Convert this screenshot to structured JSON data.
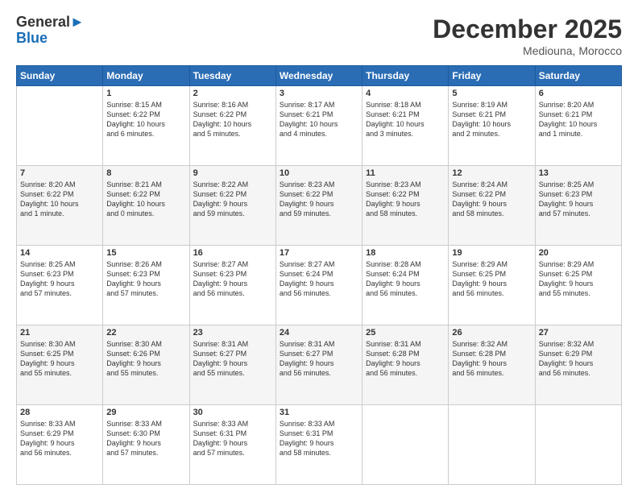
{
  "header": {
    "logo_line1": "General",
    "logo_line2": "Blue",
    "month": "December 2025",
    "location": "Mediouna, Morocco"
  },
  "weekdays": [
    "Sunday",
    "Monday",
    "Tuesday",
    "Wednesday",
    "Thursday",
    "Friday",
    "Saturday"
  ],
  "weeks": [
    [
      {
        "day": "",
        "info": ""
      },
      {
        "day": "1",
        "info": "Sunrise: 8:15 AM\nSunset: 6:22 PM\nDaylight: 10 hours\nand 6 minutes."
      },
      {
        "day": "2",
        "info": "Sunrise: 8:16 AM\nSunset: 6:22 PM\nDaylight: 10 hours\nand 5 minutes."
      },
      {
        "day": "3",
        "info": "Sunrise: 8:17 AM\nSunset: 6:21 PM\nDaylight: 10 hours\nand 4 minutes."
      },
      {
        "day": "4",
        "info": "Sunrise: 8:18 AM\nSunset: 6:21 PM\nDaylight: 10 hours\nand 3 minutes."
      },
      {
        "day": "5",
        "info": "Sunrise: 8:19 AM\nSunset: 6:21 PM\nDaylight: 10 hours\nand 2 minutes."
      },
      {
        "day": "6",
        "info": "Sunrise: 8:20 AM\nSunset: 6:21 PM\nDaylight: 10 hours\nand 1 minute."
      }
    ],
    [
      {
        "day": "7",
        "info": "Sunrise: 8:20 AM\nSunset: 6:22 PM\nDaylight: 10 hours\nand 1 minute."
      },
      {
        "day": "8",
        "info": "Sunrise: 8:21 AM\nSunset: 6:22 PM\nDaylight: 10 hours\nand 0 minutes."
      },
      {
        "day": "9",
        "info": "Sunrise: 8:22 AM\nSunset: 6:22 PM\nDaylight: 9 hours\nand 59 minutes."
      },
      {
        "day": "10",
        "info": "Sunrise: 8:23 AM\nSunset: 6:22 PM\nDaylight: 9 hours\nand 59 minutes."
      },
      {
        "day": "11",
        "info": "Sunrise: 8:23 AM\nSunset: 6:22 PM\nDaylight: 9 hours\nand 58 minutes."
      },
      {
        "day": "12",
        "info": "Sunrise: 8:24 AM\nSunset: 6:22 PM\nDaylight: 9 hours\nand 58 minutes."
      },
      {
        "day": "13",
        "info": "Sunrise: 8:25 AM\nSunset: 6:23 PM\nDaylight: 9 hours\nand 57 minutes."
      }
    ],
    [
      {
        "day": "14",
        "info": "Sunrise: 8:25 AM\nSunset: 6:23 PM\nDaylight: 9 hours\nand 57 minutes."
      },
      {
        "day": "15",
        "info": "Sunrise: 8:26 AM\nSunset: 6:23 PM\nDaylight: 9 hours\nand 57 minutes."
      },
      {
        "day": "16",
        "info": "Sunrise: 8:27 AM\nSunset: 6:23 PM\nDaylight: 9 hours\nand 56 minutes."
      },
      {
        "day": "17",
        "info": "Sunrise: 8:27 AM\nSunset: 6:24 PM\nDaylight: 9 hours\nand 56 minutes."
      },
      {
        "day": "18",
        "info": "Sunrise: 8:28 AM\nSunset: 6:24 PM\nDaylight: 9 hours\nand 56 minutes."
      },
      {
        "day": "19",
        "info": "Sunrise: 8:29 AM\nSunset: 6:25 PM\nDaylight: 9 hours\nand 56 minutes."
      },
      {
        "day": "20",
        "info": "Sunrise: 8:29 AM\nSunset: 6:25 PM\nDaylight: 9 hours\nand 55 minutes."
      }
    ],
    [
      {
        "day": "21",
        "info": "Sunrise: 8:30 AM\nSunset: 6:25 PM\nDaylight: 9 hours\nand 55 minutes."
      },
      {
        "day": "22",
        "info": "Sunrise: 8:30 AM\nSunset: 6:26 PM\nDaylight: 9 hours\nand 55 minutes."
      },
      {
        "day": "23",
        "info": "Sunrise: 8:31 AM\nSunset: 6:27 PM\nDaylight: 9 hours\nand 55 minutes."
      },
      {
        "day": "24",
        "info": "Sunrise: 8:31 AM\nSunset: 6:27 PM\nDaylight: 9 hours\nand 56 minutes."
      },
      {
        "day": "25",
        "info": "Sunrise: 8:31 AM\nSunset: 6:28 PM\nDaylight: 9 hours\nand 56 minutes."
      },
      {
        "day": "26",
        "info": "Sunrise: 8:32 AM\nSunset: 6:28 PM\nDaylight: 9 hours\nand 56 minutes."
      },
      {
        "day": "27",
        "info": "Sunrise: 8:32 AM\nSunset: 6:29 PM\nDaylight: 9 hours\nand 56 minutes."
      }
    ],
    [
      {
        "day": "28",
        "info": "Sunrise: 8:33 AM\nSunset: 6:29 PM\nDaylight: 9 hours\nand 56 minutes."
      },
      {
        "day": "29",
        "info": "Sunrise: 8:33 AM\nSunset: 6:30 PM\nDaylight: 9 hours\nand 57 minutes."
      },
      {
        "day": "30",
        "info": "Sunrise: 8:33 AM\nSunset: 6:31 PM\nDaylight: 9 hours\nand 57 minutes."
      },
      {
        "day": "31",
        "info": "Sunrise: 8:33 AM\nSunset: 6:31 PM\nDaylight: 9 hours\nand 58 minutes."
      },
      {
        "day": "",
        "info": ""
      },
      {
        "day": "",
        "info": ""
      },
      {
        "day": "",
        "info": ""
      }
    ]
  ]
}
